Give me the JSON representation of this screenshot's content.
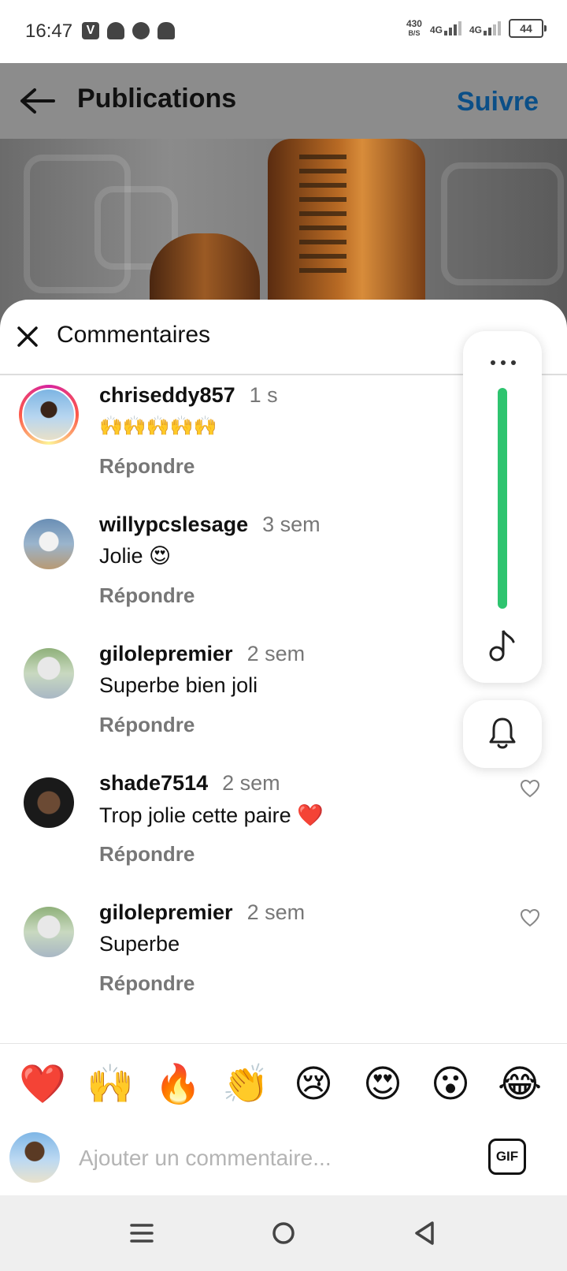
{
  "status_bar": {
    "time": "16:47",
    "speed_value": "430",
    "speed_unit": "B/S",
    "net1": "4G",
    "net2": "4G",
    "battery": "44",
    "icons": [
      "vimeo-icon",
      "snapchat-icon",
      "chat-icon",
      "android-icon"
    ]
  },
  "header": {
    "title": "Publications",
    "follow_label": "Suivre"
  },
  "comments_sheet": {
    "title": "Commentaires",
    "reply_label": "Répondre",
    "comments": [
      {
        "user": "chriseddy857",
        "time": "1 s",
        "text": "🙌🙌🙌🙌🙌",
        "story_ring": true,
        "liked": false
      },
      {
        "user": "willypcslesage",
        "time": "3 sem",
        "text": "Jolie 😍",
        "story_ring": false
      },
      {
        "user": "gilolepremier",
        "time": "2 sem",
        "text": "Superbe bien joli",
        "story_ring": false
      },
      {
        "user": "shade7514",
        "time": "2 sem",
        "text": "Trop jolie cette paire ❤️",
        "story_ring": false
      },
      {
        "user": "gilolepremier",
        "time": "2 sem",
        "text": "Superbe",
        "story_ring": false
      }
    ]
  },
  "tool_panel": {
    "accent": "#2ec46f",
    "icons": [
      "more-icon",
      "music-icon",
      "bell-icon"
    ]
  },
  "emoji_bar": [
    "❤️",
    "🙌",
    "🔥",
    "👏",
    "😢",
    "😍",
    "😮",
    "😂"
  ],
  "composer": {
    "placeholder": "Ajouter un commentaire...",
    "gif_label": "GIF"
  },
  "colors": {
    "follow": "#0b4f87",
    "muted": "#777777"
  }
}
